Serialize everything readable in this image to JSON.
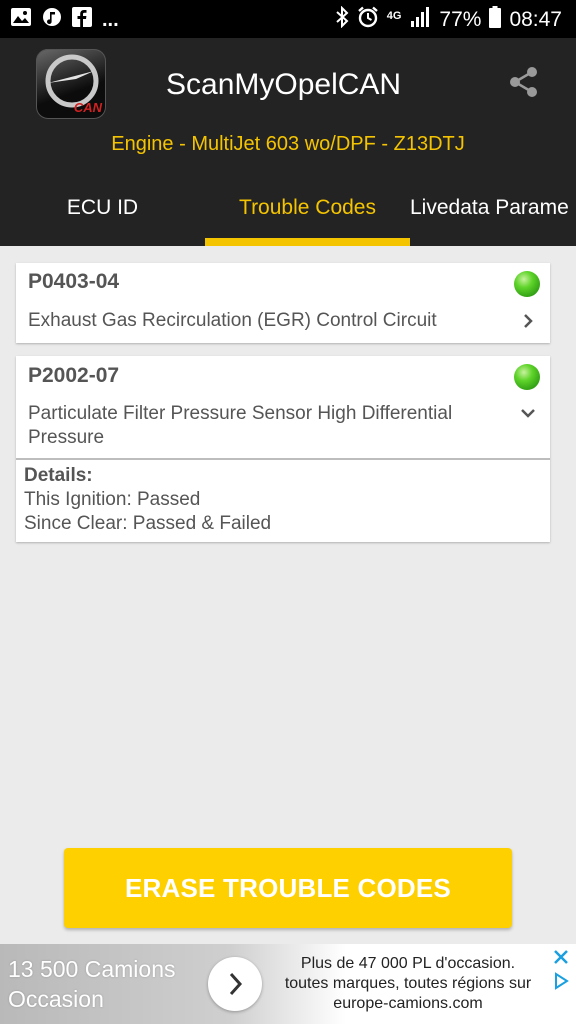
{
  "status_bar": {
    "overflow": "...",
    "network": "4G",
    "battery": "77%",
    "time": "08:47",
    "icons_left": [
      "gallery-icon",
      "music-icon",
      "facebook-icon"
    ],
    "icons_right": [
      "bluetooth-icon",
      "alarm-icon",
      "signal-icon",
      "battery-icon"
    ]
  },
  "header": {
    "logo_text": "CAN",
    "title": "ScanMyOpelCAN",
    "subtitle": "Engine - MultiJet 603 wo/DPF - Z13DTJ"
  },
  "tabs": [
    {
      "label": "ECU ID",
      "active": false
    },
    {
      "label": "Trouble Codes",
      "active": true
    },
    {
      "label": "Livedata Parame",
      "active": false
    }
  ],
  "trouble_codes": [
    {
      "code": "P0403-04",
      "description": "Exhaust Gas Recirculation (EGR) Control Circuit",
      "status_color": "#4cc320",
      "expanded": false
    },
    {
      "code": "P2002-07",
      "description": "Particulate Filter Pressure Sensor High Differential Pressure",
      "status_color": "#4cc320",
      "expanded": true,
      "details_title": "Details:",
      "details_line1": "This Ignition: Passed",
      "details_line2": "Since Clear: Passed & Failed"
    }
  ],
  "erase_button": {
    "label": "ERASE TROUBLE CODES",
    "color": "#ffd000"
  },
  "ad": {
    "left_line1": "13 500 Camions",
    "left_line2": "Occasion",
    "right_line1": "Plus de 47 000 PL d'occasion.",
    "right_line2": "toutes marques, toutes régions sur",
    "right_line3": "europe-camions.com"
  },
  "colors": {
    "accent": "#f5c400",
    "header_bg": "#232323",
    "ad_icon": "#1aa0e0"
  }
}
